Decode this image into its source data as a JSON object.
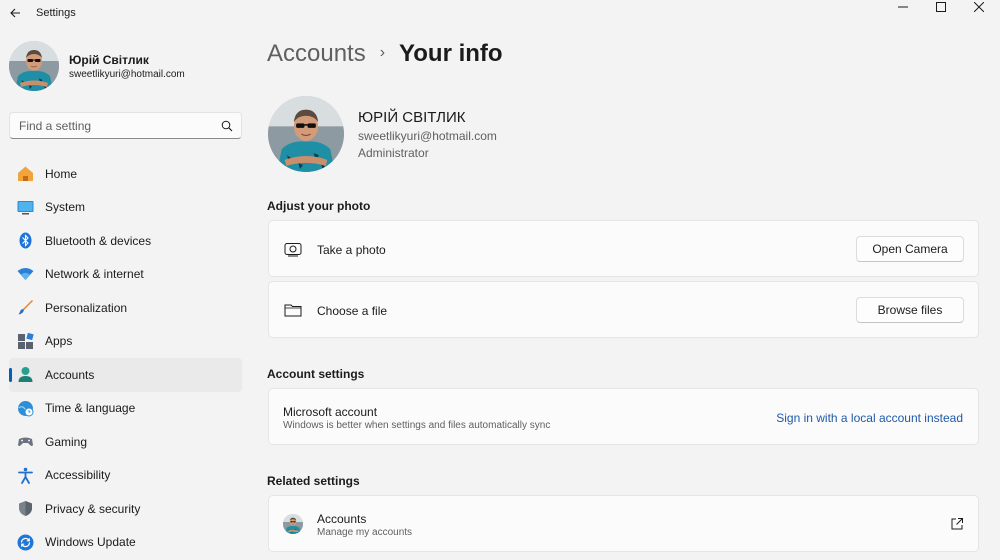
{
  "window": {
    "title": "Settings"
  },
  "profile": {
    "name": "Юрій Світлик",
    "email": "sweetlikyuri@hotmail.com"
  },
  "search": {
    "placeholder": "Find a setting"
  },
  "nav": {
    "items": [
      {
        "label": "Home",
        "icon": "home-icon"
      },
      {
        "label": "System",
        "icon": "system-icon"
      },
      {
        "label": "Bluetooth & devices",
        "icon": "bluetooth-icon"
      },
      {
        "label": "Network & internet",
        "icon": "network-icon"
      },
      {
        "label": "Personalization",
        "icon": "personalization-icon"
      },
      {
        "label": "Apps",
        "icon": "apps-icon"
      },
      {
        "label": "Accounts",
        "icon": "accounts-icon",
        "active": true
      },
      {
        "label": "Time & language",
        "icon": "time-language-icon"
      },
      {
        "label": "Gaming",
        "icon": "gaming-icon"
      },
      {
        "label": "Accessibility",
        "icon": "accessibility-icon"
      },
      {
        "label": "Privacy & security",
        "icon": "privacy-shield-icon"
      },
      {
        "label": "Windows Update",
        "icon": "windows-update-icon"
      }
    ]
  },
  "breadcrumb": {
    "parent": "Accounts",
    "separator": "›",
    "current": "Your info"
  },
  "user": {
    "name": "ЮРІЙ СВІТЛИК",
    "email": "sweetlikyuri@hotmail.com",
    "role": "Administrator"
  },
  "adjust_photo": {
    "title": "Adjust your photo",
    "take_photo_label": "Take a photo",
    "open_camera_button": "Open Camera",
    "choose_file_label": "Choose a file",
    "browse_files_button": "Browse files"
  },
  "account_settings": {
    "title": "Account settings",
    "microsoft_account_label": "Microsoft account",
    "microsoft_account_desc": "Windows is better when settings and files automatically sync",
    "local_account_link": "Sign in with a local account instead"
  },
  "related_settings": {
    "title": "Related settings",
    "accounts_label": "Accounts",
    "accounts_desc": "Manage my accounts"
  },
  "colors": {
    "accent": "#005fb8",
    "link": "#1f5aa8",
    "background": "#f3f3f3",
    "card": "#fbfbfb"
  }
}
